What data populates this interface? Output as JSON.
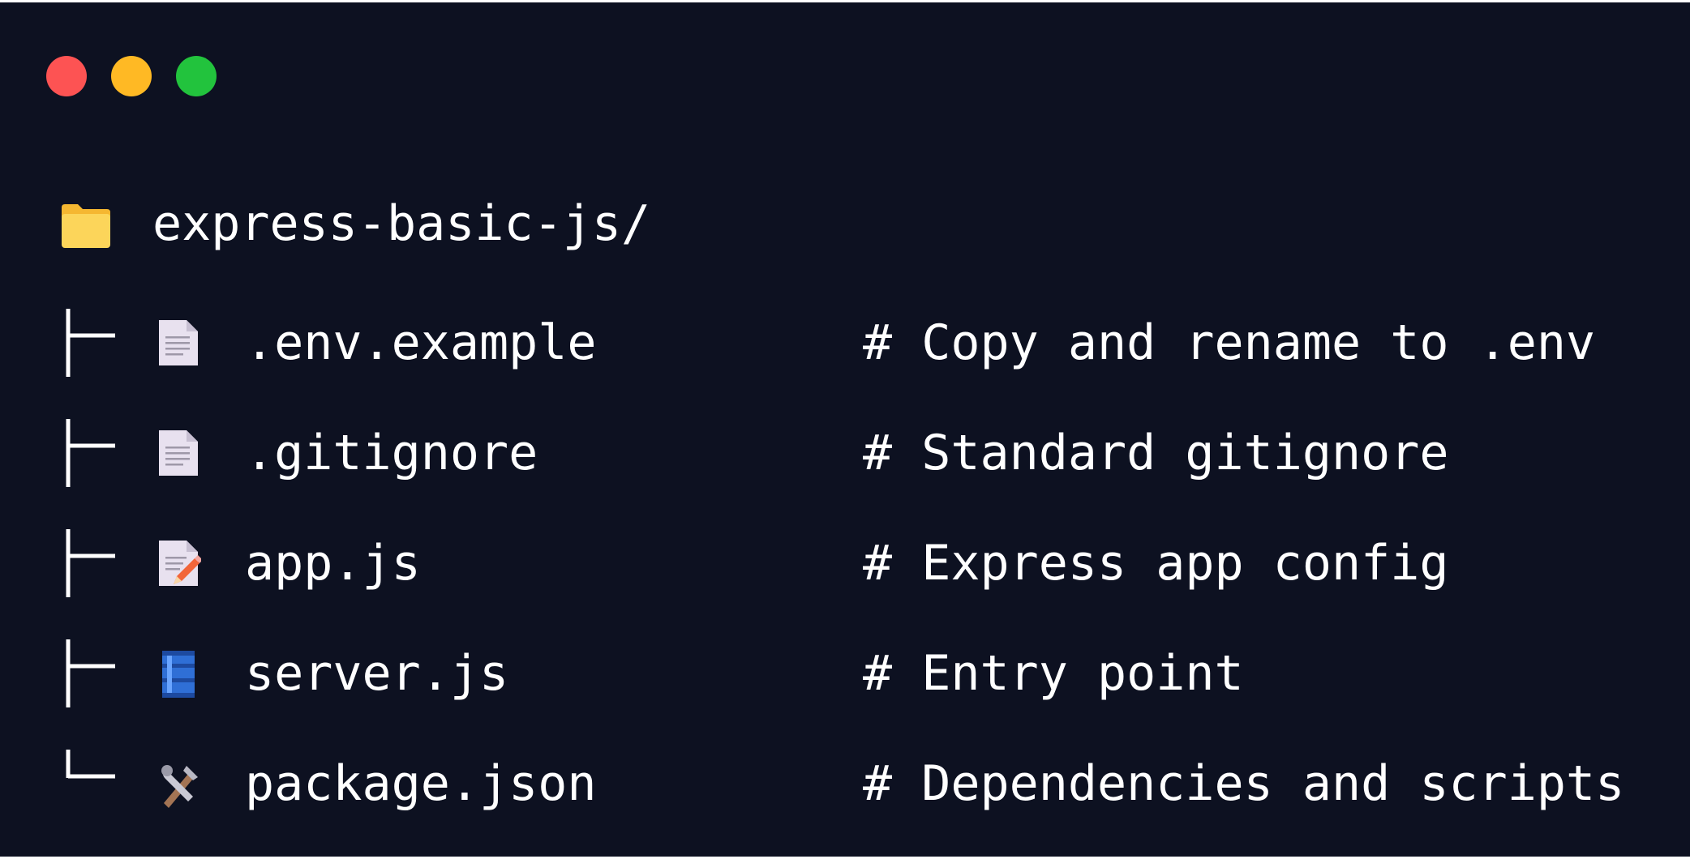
{
  "window": {
    "controls": [
      {
        "name": "close",
        "color": "#fd5353"
      },
      {
        "name": "minimize",
        "color": "#ffb924"
      },
      {
        "name": "maximize",
        "color": "#22c33d"
      }
    ]
  },
  "tree": {
    "root": {
      "label": "express-basic-js/",
      "icon": "folder-icon"
    },
    "items": [
      {
        "branch": "├─",
        "icon": "page-icon",
        "name": ".env.example",
        "comment": "# Copy and rename to .env"
      },
      {
        "branch": "├─",
        "icon": "page-icon",
        "name": ".gitignore",
        "comment": "# Standard gitignore"
      },
      {
        "branch": "├─",
        "icon": "memo-icon",
        "name": "app.js",
        "comment": "# Express app config"
      },
      {
        "branch": "├─",
        "icon": "barrel-icon",
        "name": "server.js",
        "comment": "# Entry point"
      },
      {
        "branch": "└─",
        "icon": "tools-icon",
        "name": "package.json",
        "comment": "# Dependencies and scripts"
      }
    ]
  }
}
